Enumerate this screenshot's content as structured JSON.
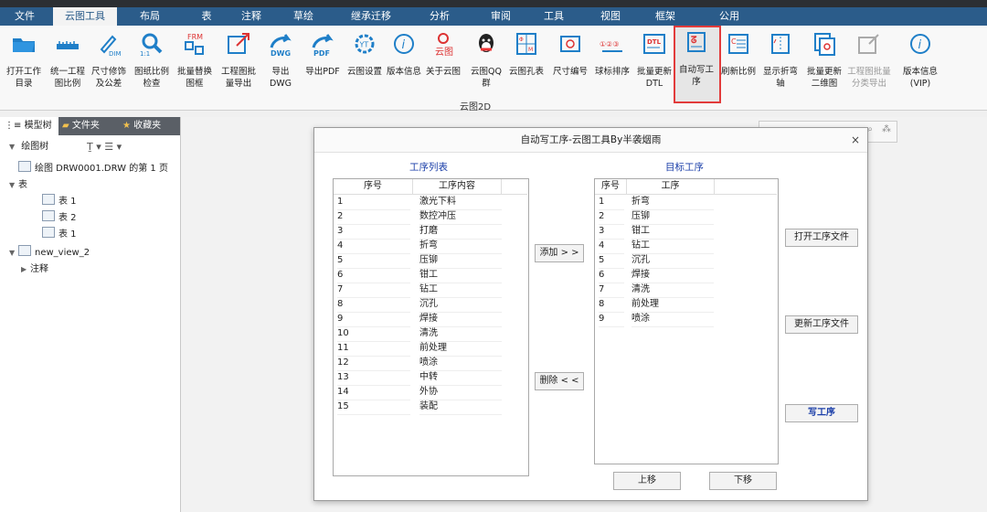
{
  "menus": [
    "文件",
    "云图工具",
    "布局",
    "表",
    "注释",
    "草绘",
    "继承迁移",
    "分析",
    "审阅",
    "工具",
    "视图",
    "框架",
    "公用"
  ],
  "active_menu": "云图工具",
  "ribbon": {
    "group_label": "云图2D",
    "buttons": [
      {
        "label": "打开工作\n目录",
        "icon": "folder-icon"
      },
      {
        "label": "统一工程\n图比例",
        "icon": "ruler-icon"
      },
      {
        "label": "尺寸修饰\n及公差",
        "icon": "pen-dim-icon"
      },
      {
        "label": "图纸比例\n检查",
        "icon": "magnifier-icon"
      },
      {
        "label": "批量替换\n图框",
        "icon": "frm-icon"
      },
      {
        "label": "工程图批\n量导出",
        "icon": "export-icon"
      },
      {
        "label": "导出\nDWG",
        "icon": "dwg-icon"
      },
      {
        "label": "导出PDF",
        "icon": "pdf-icon"
      },
      {
        "label": "云图设置",
        "icon": "gear-icon"
      },
      {
        "label": "版本信息",
        "icon": "info-icon"
      },
      {
        "label": "关于云图",
        "icon": "about-icon"
      },
      {
        "label": "云图QQ\n群",
        "icon": "qq-icon"
      },
      {
        "label": "云图孔表",
        "icon": "hole-table-icon"
      },
      {
        "label": "尺寸编号",
        "icon": "dim-number-icon"
      },
      {
        "label": "球标排序",
        "icon": "balloon-icon"
      },
      {
        "label": "批量更新\nDTL",
        "icon": "dtl-icon"
      },
      {
        "label": "自动写工\n序",
        "icon": "auto-process-icon"
      },
      {
        "label": "刷新比例",
        "icon": "refresh-scale-icon"
      },
      {
        "label": "显示折弯\n轴",
        "icon": "bend-axis-icon"
      },
      {
        "label": "批量更新\n二维图",
        "icon": "update-2d-icon"
      },
      {
        "label": "工程图批量\n分类导出",
        "icon": "classify-export-icon",
        "disabled": true
      },
      {
        "label": "版本信息\n(VIP)",
        "icon": "info-vip-icon"
      }
    ]
  },
  "panel": {
    "tabs": [
      "模型树",
      "文件夹",
      "收藏夹"
    ],
    "toolbar_label": "绘图树",
    "tree": [
      {
        "text": "绘图 DRW0001.DRW 的第 1 页",
        "indent": 0,
        "icon": "drawing-icon",
        "arrow": ""
      },
      {
        "text": "表",
        "indent": 0,
        "icon": "",
        "arrow": "▼"
      },
      {
        "text": "表 1",
        "indent": 2,
        "icon": "table-icon",
        "arrow": ""
      },
      {
        "text": "表 2",
        "indent": 2,
        "icon": "table-icon",
        "arrow": ""
      },
      {
        "text": "表 1",
        "indent": 2,
        "icon": "table-icon",
        "arrow": ""
      },
      {
        "text": "new_view_2",
        "indent": 0,
        "icon": "view-icon",
        "arrow": "▼"
      },
      {
        "text": "注释",
        "indent": 1,
        "icon": "",
        "arrow": "▶"
      }
    ]
  },
  "dialog": {
    "title": "自动写工序-云图工具By半袭烟雨",
    "close": "×",
    "left_title": "工序列表",
    "right_title": "目标工序",
    "left_headers": [
      "序号",
      "工序内容"
    ],
    "right_headers": [
      "序号",
      "工序"
    ],
    "left_rows": [
      [
        "1",
        "激光下料"
      ],
      [
        "2",
        "数控冲压"
      ],
      [
        "3",
        "打磨"
      ],
      [
        "4",
        "折弯"
      ],
      [
        "5",
        "压铆"
      ],
      [
        "6",
        "钳工"
      ],
      [
        "7",
        "钻工"
      ],
      [
        "8",
        "沉孔"
      ],
      [
        "9",
        "焊接"
      ],
      [
        "10",
        "清洗"
      ],
      [
        "11",
        "前处理"
      ],
      [
        "12",
        "喷涂"
      ],
      [
        "13",
        "中转"
      ],
      [
        "14",
        "外协"
      ],
      [
        "15",
        "装配"
      ]
    ],
    "right_rows": [
      [
        "1",
        "折弯"
      ],
      [
        "2",
        "压铆"
      ],
      [
        "3",
        "钳工"
      ],
      [
        "4",
        "钻工"
      ],
      [
        "5",
        "沉孔"
      ],
      [
        "6",
        "焊接"
      ],
      [
        "7",
        "清洗"
      ],
      [
        "8",
        "前处理"
      ],
      [
        "9",
        "喷涂"
      ]
    ],
    "buttons": {
      "add": "添加 > >",
      "remove": "删除 < <",
      "open_file": "打开工序文件",
      "update_file": "更新工序文件",
      "write": "写工序",
      "up": "上移",
      "down": "下移"
    }
  },
  "colors": {
    "menubar": "#2b5c8a",
    "highlight": "#e23b3b",
    "label_blue": "#1a3ea8"
  }
}
